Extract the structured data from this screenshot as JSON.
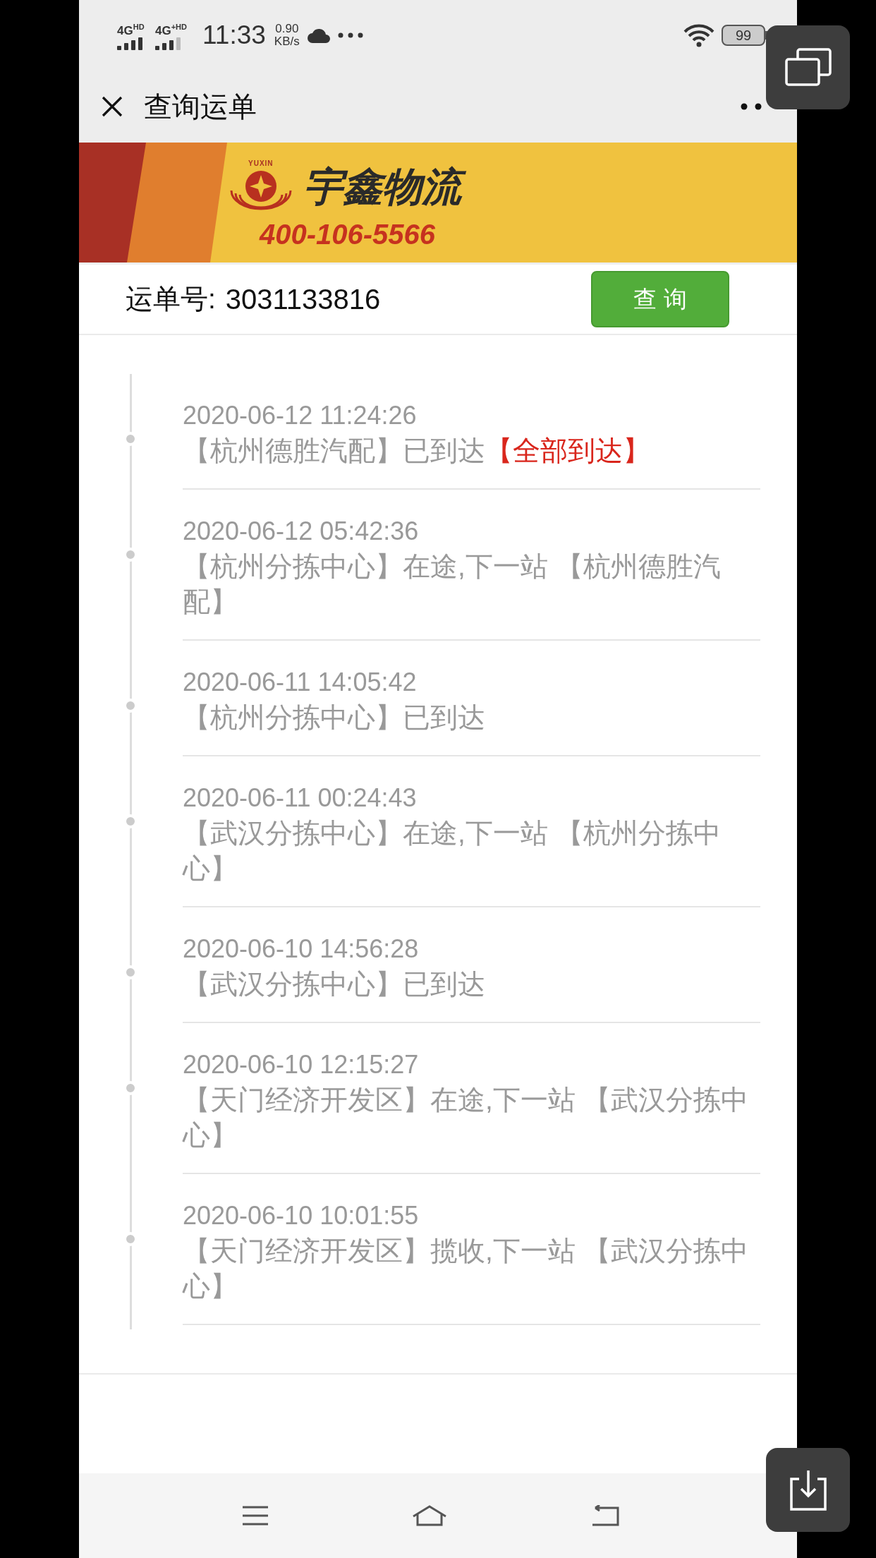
{
  "status_bar": {
    "networks": [
      {
        "label": "4G$^{HD}$"
      },
      {
        "label": "4G$^{+HD}$"
      }
    ],
    "time": "11:33",
    "speed": "0.90",
    "speed_unit": "KB/s",
    "battery": "99"
  },
  "header": {
    "title": "查询运单"
  },
  "banner": {
    "logo_caption": "YUXIN",
    "brand": "宇鑫物流",
    "phone": "400-106-5566"
  },
  "query": {
    "label": "运单号:",
    "waybill": "3031133816",
    "button": "查 询"
  },
  "events": [
    {
      "time": "2020-06-12 11:24:26",
      "text": "【杭州德胜汽配】已到达",
      "status": "【全部到达】"
    },
    {
      "time": "2020-06-12 05:42:36",
      "text": "【杭州分拣中心】在途,下一站 【杭州德胜汽配】"
    },
    {
      "time": "2020-06-11 14:05:42",
      "text": "【杭州分拣中心】已到达"
    },
    {
      "time": "2020-06-11 00:24:43",
      "text": "【武汉分拣中心】在途,下一站 【杭州分拣中心】"
    },
    {
      "time": "2020-06-10 14:56:28",
      "text": "【武汉分拣中心】已到达"
    },
    {
      "time": "2020-06-10 12:15:27",
      "text": "【天门经济开发区】在途,下一站 【武汉分拣中心】"
    },
    {
      "time": "2020-06-10 10:01:55",
      "text": "【天门经济开发区】揽收,下一站 【武汉分拣中心】"
    }
  ]
}
